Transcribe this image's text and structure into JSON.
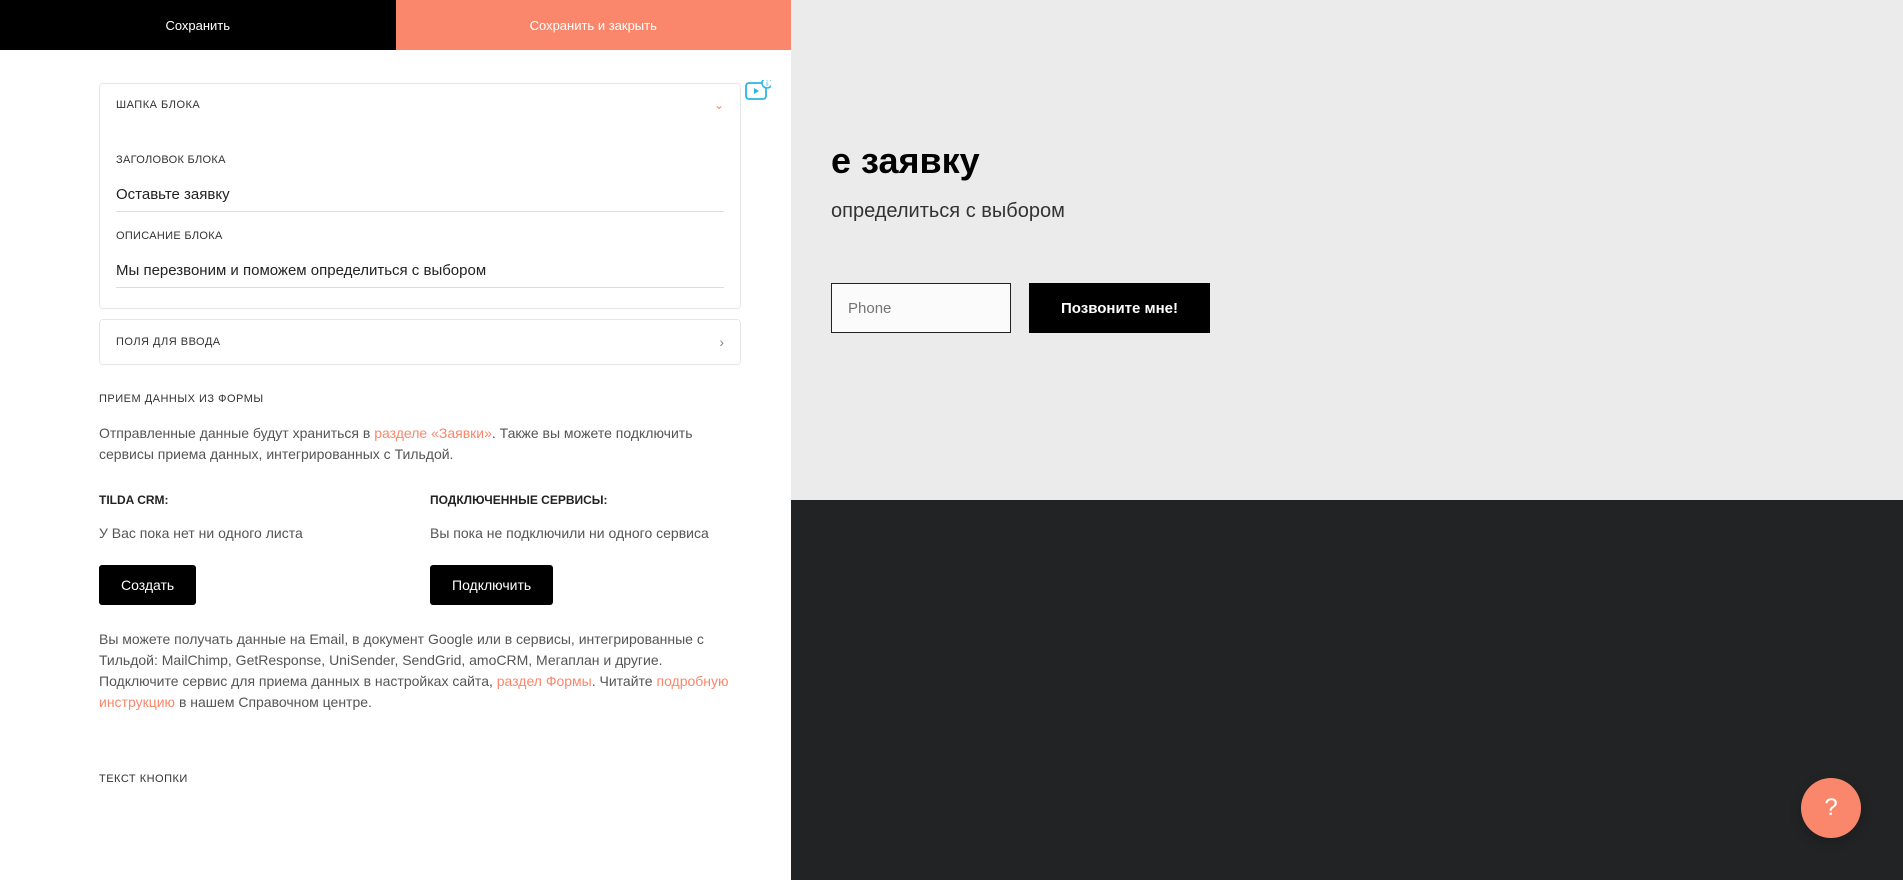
{
  "tabs": {
    "save": "Сохранить",
    "save_close": "Сохранить и закрыть"
  },
  "accordion": {
    "header_section": "ШАПКА БЛОКА",
    "title_label": "ЗАГОЛОВОК БЛОКА",
    "title_value": "Оставьте заявку",
    "desc_label": "ОПИСАНИЕ БЛОКА",
    "desc_value": "Мы перезвоним и поможем определиться с выбором",
    "fields_section": "ПОЛЯ ДЛЯ ВВОДА"
  },
  "form_receiver": {
    "title": "ПРИЕМ ДАННЫХ ИЗ ФОРМЫ",
    "intro_a": "Отправленные данные будут храниться в ",
    "intro_link": "разделе «Заявки»",
    "intro_b": ". Также вы можете подключить сервисы приема данных, интегрированных с Тильдой.",
    "crm_title": "TILDA CRM:",
    "crm_text": "У Вас пока нет ни одного листа",
    "crm_btn": "Создать",
    "services_title": "ПОДКЛЮЧЕННЫЕ СЕРВИСЫ:",
    "services_text": "Вы пока не подключили ни одного сервиса",
    "services_btn": "Подключить",
    "note_a": "Вы можете получать данные на Email, в документ Google или в сервисы, интегрированные с Тильдой: MailChimp, GetResponse, UniSender, SendGrid, amoCRM, Мегаплан и другие. Подключите сервис для приема данных в настройках сайта, ",
    "note_link1": "раздел Формы",
    "note_mid": ". Читайте ",
    "note_link2": "подробную инструкцию",
    "note_b": " в нашем Справочном центре."
  },
  "button_text_section": "ТЕКСТ КНОПКИ",
  "preview": {
    "title_fragment": "е заявку",
    "desc_fragment": "определиться с выбором",
    "phone_placeholder": "Phone",
    "button_label": "Позвоните мне!"
  },
  "help_glyph": "?"
}
